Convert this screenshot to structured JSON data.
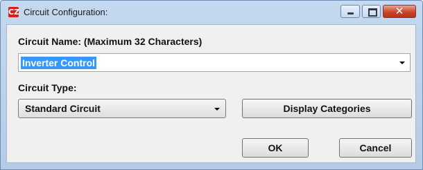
{
  "window": {
    "title": "Circuit Configuration:",
    "icon": "cz-app-icon",
    "icon_text": "CZ",
    "controls": {
      "minimize": "minimize-icon",
      "maximize": "maximize-icon",
      "close": "close-icon",
      "close_glyph": "✕"
    }
  },
  "form": {
    "circuit_name_label": "Circuit Name: (Maximum 32 Characters)",
    "circuit_name_value": "Inverter Control",
    "circuit_type_label": "Circuit Type:",
    "circuit_type_value": "Standard Circuit"
  },
  "buttons": {
    "display_categories": "Display Categories",
    "ok": "OK",
    "cancel": "Cancel"
  },
  "colors": {
    "selection": "#3399ff",
    "title_bar": "#c4d8ef",
    "close_button": "#c8452c",
    "dialog_background": "#f0f0f0"
  }
}
